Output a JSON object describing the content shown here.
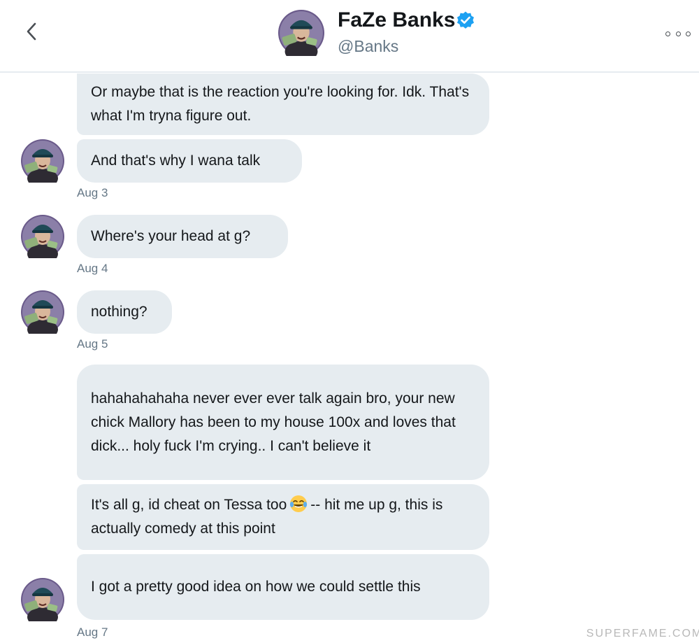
{
  "header": {
    "name": "FaZe Banks",
    "handle": "@Banks",
    "verified": true,
    "back_icon": "chevron-left-icon",
    "more_icon": "more-options-icon"
  },
  "messages": [
    {
      "text": "Or maybe that is the reaction you're looking for. Idk. That's what I'm tryna figure out."
    },
    {
      "text": "And that's why I wana talk"
    },
    {
      "text": "Where's your head at g?"
    },
    {
      "text": "nothing?"
    },
    {
      "text": "hahahahahaha never ever ever talk again bro, your new chick Mallory has been to my house 100x and loves that dick... holy fuck I'm crying.. I can't believe it"
    },
    {
      "text_before": "It's all g, id cheat on Tessa too",
      "emoji": "face-with-tears-of-joy",
      "text_after": "-- hit me up g, this is actually comedy at this point"
    },
    {
      "text": "I got a pretty good idea on how we could settle this"
    }
  ],
  "dates": [
    "Aug 3",
    "Aug 4",
    "Aug 5",
    "Aug 7"
  ],
  "watermark": "SUPERFAME.COM",
  "colors": {
    "bubble_bg": "#e6ecf0",
    "verified_blue": "#1da1f2",
    "meta_text": "#657786"
  }
}
